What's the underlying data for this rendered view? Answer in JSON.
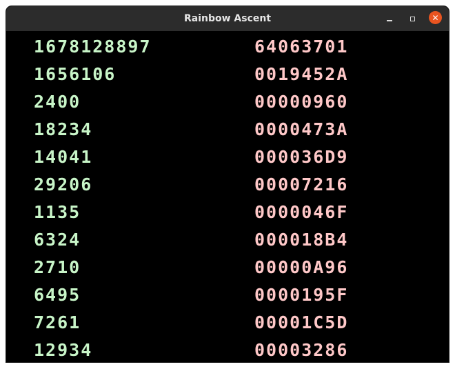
{
  "window": {
    "title": "Rainbow Ascent",
    "controls": {
      "minimize": "minimize-icon",
      "maximize": "maximize-icon",
      "close": "close-icon"
    }
  },
  "colors": {
    "decimal_text": "#c8f5c8",
    "hex_text": "#ffc8c8",
    "background": "#000000",
    "titlebar": "#2c2c2c",
    "close_button": "#e95420"
  },
  "rows": [
    {
      "decimal": "1678128897",
      "hex": "64063701"
    },
    {
      "decimal": "1656106",
      "hex": "0019452A"
    },
    {
      "decimal": "2400",
      "hex": "00000960"
    },
    {
      "decimal": "18234",
      "hex": "0000473A"
    },
    {
      "decimal": "14041",
      "hex": "000036D9"
    },
    {
      "decimal": "29206",
      "hex": "00007216"
    },
    {
      "decimal": "1135",
      "hex": "0000046F"
    },
    {
      "decimal": "6324",
      "hex": "000018B4"
    },
    {
      "decimal": "2710",
      "hex": "00000A96"
    },
    {
      "decimal": "6495",
      "hex": "0000195F"
    },
    {
      "decimal": "7261",
      "hex": "00001C5D"
    },
    {
      "decimal": "12934",
      "hex": "00003286"
    }
  ]
}
